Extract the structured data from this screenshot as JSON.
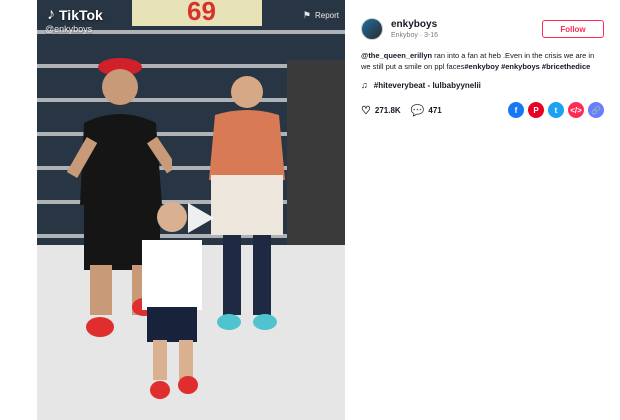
{
  "video": {
    "logo_text": "TikTok",
    "handle_overlay": "@enkyboys",
    "report_label": "Report",
    "price_sign": "69"
  },
  "author": {
    "name": "enkyboys",
    "subtitle": "Enkyboy · 3-16"
  },
  "follow_label": "Follow",
  "caption": {
    "mention": "@the_queen_erillyn",
    "text": " ran into a fan at heb .Even in the crisis we are in we still put a smile on ppl faces",
    "tags": "#enkyboy #enkyboys #bricethedice"
  },
  "music": {
    "title": "#hiteverybeat - lulbabyynelii"
  },
  "stats": {
    "likes": "271.8K",
    "comments": "471"
  },
  "colors": {
    "accent": "#fe2c55",
    "facebook": "#1877f2",
    "pinterest": "#e60023",
    "twitter": "#1da1f2",
    "embed": "#fe2c55",
    "link": "#6a7cff"
  },
  "icons": {
    "share": [
      "facebook-icon",
      "pinterest-icon",
      "twitter-icon",
      "embed-icon",
      "link-icon"
    ]
  }
}
